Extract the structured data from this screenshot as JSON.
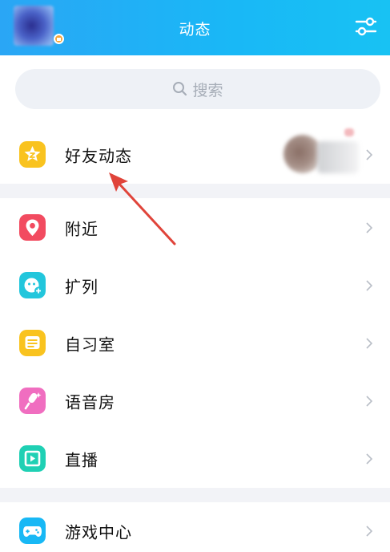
{
  "header": {
    "title": "动态",
    "background_color": "#1ab4f6"
  },
  "search": {
    "placeholder": "搜索"
  },
  "rows": [
    {
      "label": "好友动态",
      "icon": "star-icon",
      "color": "#f9c31f"
    },
    {
      "label": "附近",
      "icon": "location-pin-icon",
      "color": "#f24b60"
    },
    {
      "label": "扩列",
      "icon": "add-friend-face-icon",
      "color": "#22c6dc"
    },
    {
      "label": "自习室",
      "icon": "study-room-icon",
      "color": "#f9c31f"
    },
    {
      "label": "语音房",
      "icon": "microphone-icon",
      "color": "#f06ec0"
    },
    {
      "label": "直播",
      "icon": "live-play-icon",
      "color": "#1fd0b4"
    },
    {
      "label": "游戏中心",
      "icon": "gamepad-icon",
      "color": "#18b8f5"
    }
  ],
  "annotation": {
    "arrow_color": "#e0443a",
    "points_to": "好友动态"
  }
}
